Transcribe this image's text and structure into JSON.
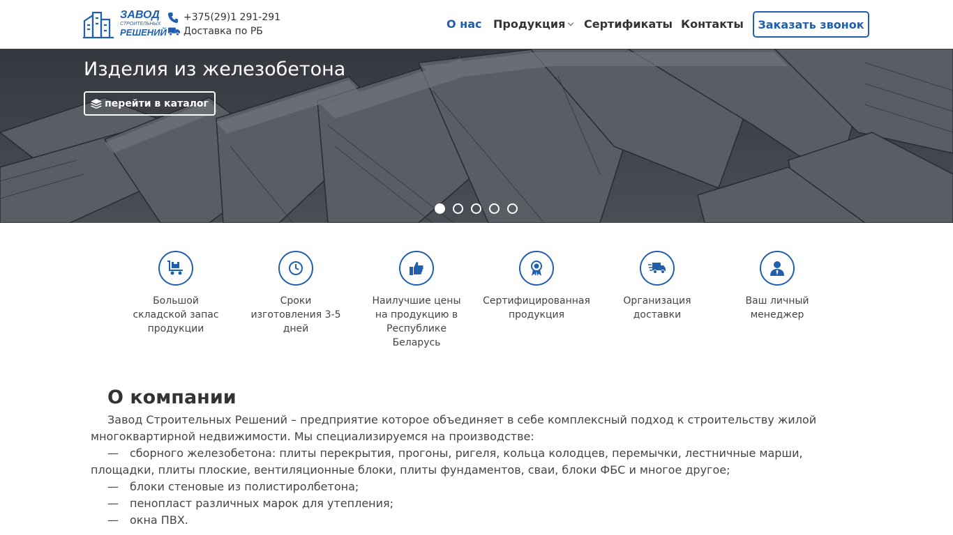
{
  "header": {
    "logo": {
      "line1": "ЗАВОД",
      "line2": "СТРОИТЕЛЬНЫХ",
      "line3": "РЕШЕНИЙ"
    },
    "phone": "+375(29)1 291-291",
    "delivery": "Доставка по РБ",
    "nav": [
      {
        "label": "О нас",
        "active": true
      },
      {
        "label": "Продукция",
        "has_dropdown": true
      },
      {
        "label": "Сертификаты"
      },
      {
        "label": "Контакты"
      }
    ],
    "callback_label": "Заказать звонок",
    "accent_color": "#1f5fae"
  },
  "hero": {
    "title": "Изделия из железобетона",
    "button_label": "перейти в каталог",
    "slides_count": 5,
    "active_slide": 1
  },
  "features": [
    {
      "icon": "warehouse-cart-icon",
      "text": "Большой складской запас продукции"
    },
    {
      "icon": "clock-icon",
      "text": "Сроки изготовления 3-5 дней"
    },
    {
      "icon": "thumbs-up-icon",
      "text": "Наилучшие цены на продукцию в Республике Беларусь"
    },
    {
      "icon": "certificate-award-icon",
      "text": "Сертифицированная продукция"
    },
    {
      "icon": "delivery-truck-icon",
      "text": "Организация доставки"
    },
    {
      "icon": "manager-icon",
      "text": "Ваш личный менеджер"
    }
  ],
  "about": {
    "heading": "О компании",
    "intro": "Завод Строительных Решений – предприятие которое объединяет в себе комплексный подход к строительству жилой многоквартирной недвижимости. Мы специализируемся на производстве:",
    "dash": "—",
    "items": [
      "сборного железобетона: плиты перекрытия, прогоны, ригеля, кольца колодцев, перемычки, лестничные марши, площадки, плиты плоские, вентиляционные блоки, плиты фундаментов, сваи, блоки ФБС и многое другое;",
      "блоки стеновые из полистиролбетона;",
      "пенопласт различных марок для утепления;",
      "окна ПВХ."
    ]
  }
}
